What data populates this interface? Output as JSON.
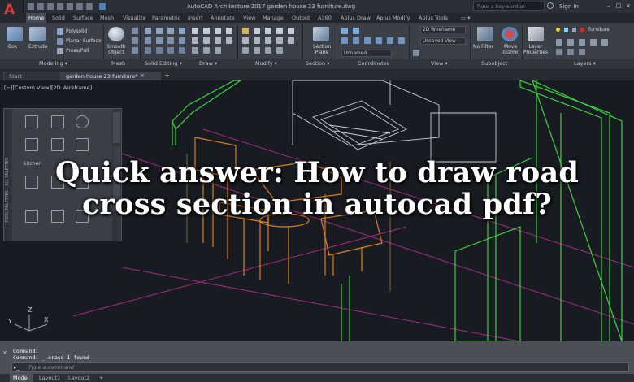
{
  "app": {
    "logo_letter": "A",
    "window_title": "AutoCAD Architecture 2017   garden house 23 furniture.dwg",
    "search_placeholder": "Type a keyword or phrase",
    "sign_in": "Sign In",
    "window_buttons": [
      "–",
      "□",
      "×"
    ]
  },
  "ribbon_tabs": [
    "Home",
    "Solid",
    "Surface",
    "Mesh",
    "Visualize",
    "Parametric",
    "Insert",
    "Annotate",
    "View",
    "Manage",
    "Output",
    "A360",
    "Aplus Draw",
    "Aplus Modify",
    "Aplus Tools"
  ],
  "ribbon": {
    "buttons": {
      "box": "Box",
      "extrude": "Extrude",
      "polysolid": "Polysolid",
      "planar_surface": "Planar Surface",
      "presspull": "Press/Pull",
      "smooth_object": "Smooth Object",
      "section_plane": "Section Plane",
      "no_filter": "No Filter",
      "move_gizmo": "Move Gizmo",
      "layer_properties": "Layer Properties"
    },
    "dropdowns": {
      "visual_style": "2D Wireframe",
      "view": "Unsaved View",
      "coordinates": "Unnamed",
      "layer": "furniture"
    },
    "panels": [
      "Modeling ▾",
      "Mesh",
      "Solid Editing ▾",
      "Draw ▾",
      "Modify ▾",
      "Section ▾",
      "Coordinates",
      "View ▾",
      "Subobject",
      "Layers ▾"
    ]
  },
  "file_tabs": [
    "Start",
    "garden house 23 furniture*"
  ],
  "viewport": {
    "label": "[−][Custom View][2D Wireframe]",
    "palette_label": "kitchen",
    "palette_side_text": "TOOL PALETTES - ALL PALETTES",
    "ucs_axes": [
      "Y",
      "Z",
      "X"
    ]
  },
  "headline": "Quick answer: How to draw road cross section in autocad pdf?",
  "command": {
    "history": [
      "Command:",
      "Command:  _.erase 1 found"
    ],
    "prompt": "Type a command"
  },
  "layout_tabs": [
    "Model",
    "Layout1",
    "Layout2",
    "+"
  ],
  "colors": {
    "wire_green": "#3fd23f",
    "wire_orange": "#d9821e",
    "wire_magenta": "#b0308a",
    "wire_white": "#c9ced6",
    "headline": "#ffffff",
    "logo_red": "#d93a3a"
  }
}
